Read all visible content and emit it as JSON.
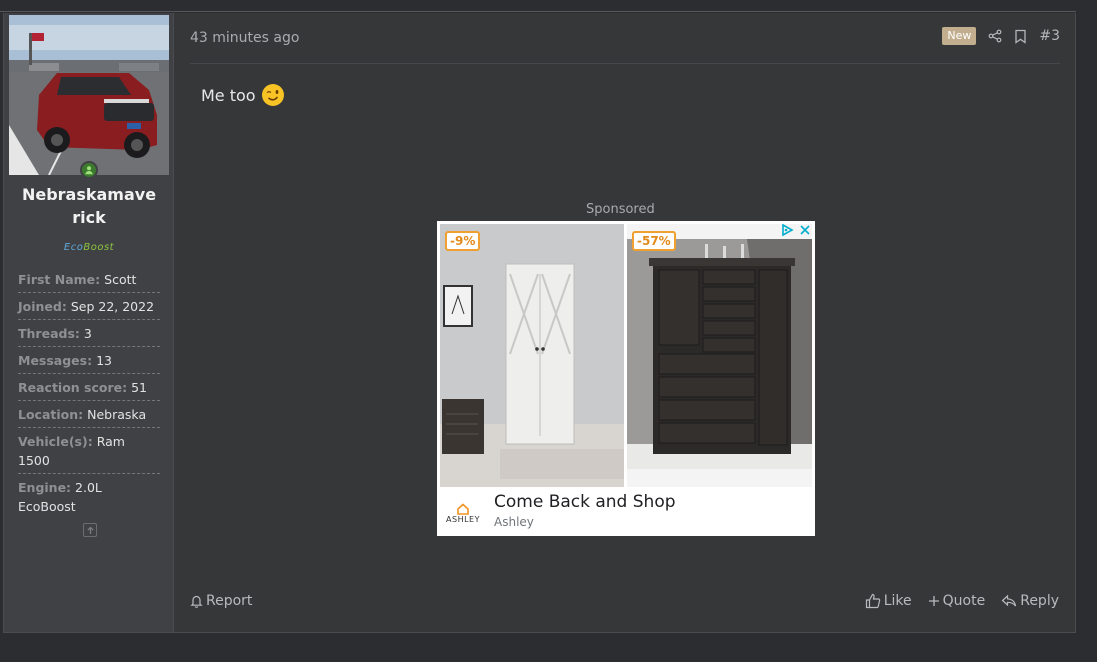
{
  "user": {
    "name_line1": "Nebraskamave",
    "name_line2": "rick",
    "title_eco": "Eco",
    "title_boost": "Boost",
    "stats": [
      {
        "label": "First Name:",
        "value": "Scott"
      },
      {
        "label": "Joined:",
        "value": "Sep 22, 2022"
      },
      {
        "label": "Threads:",
        "value": "3"
      },
      {
        "label": "Messages:",
        "value": "13"
      },
      {
        "label": "Reaction score:",
        "value": "51"
      },
      {
        "label": "Location:",
        "value": "Nebraska"
      },
      {
        "label": "Vehicle(s):",
        "value": "Ram 1500"
      },
      {
        "label": "Engine:",
        "value": "2.0L EcoBoost"
      }
    ]
  },
  "post": {
    "time": "43 minutes ago",
    "badge": "New",
    "number": "#3",
    "message": "Me too",
    "emoji": "😉"
  },
  "ad": {
    "sponsored": "Sponsored",
    "discount1": "-9%",
    "discount2": "-57%",
    "title": "Come Back and Shop",
    "advertiser": "Ashley",
    "logo_text": "ASHLEY"
  },
  "footer": {
    "report": "Report",
    "like": "Like",
    "quote": "Quote",
    "reply": "Reply"
  },
  "icons": [
    "share-icon",
    "bookmark-icon",
    "bell-icon",
    "thumbs-up-icon",
    "plus-icon",
    "reply-icon",
    "online-user-icon",
    "scroll-up-icon",
    "adchoices-icon",
    "close-icon",
    "ashley-logo-icon"
  ],
  "colors": {
    "background": "#2c2d31",
    "panel": "#404144",
    "post": "#363739",
    "badge": "#c2ae8f",
    "eco": "#5fa8d8",
    "boost": "#8cc63f",
    "discount": "#f0a030"
  }
}
